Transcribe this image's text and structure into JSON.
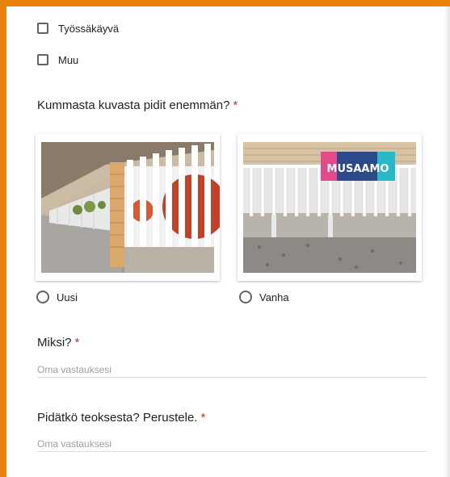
{
  "checkbox_options": [
    {
      "label": "Työssäkäyvä",
      "checked": false
    },
    {
      "label": "Muu",
      "checked": false
    }
  ],
  "question_images": {
    "title": "Kummasta kuvasta pidit enemmän?",
    "required_mark": "*",
    "options": [
      {
        "label": "Uusi",
        "selected": false,
        "image": "fence-with-mural-photo"
      },
      {
        "label": "Vanha",
        "selected": false,
        "image": "fence-with-musaamo-banner-photo",
        "banner_text": "MUSAAMO"
      }
    ]
  },
  "question_why": {
    "title": "Miksi?",
    "required_mark": "*",
    "placeholder": "Oma vastauksesi"
  },
  "question_opinion": {
    "title": "Pidätkö teoksesta? Perustele.",
    "required_mark": "*",
    "placeholder": "Oma vastauksesi"
  },
  "colors": {
    "accent": "#e8820c",
    "required": "#d93025"
  }
}
